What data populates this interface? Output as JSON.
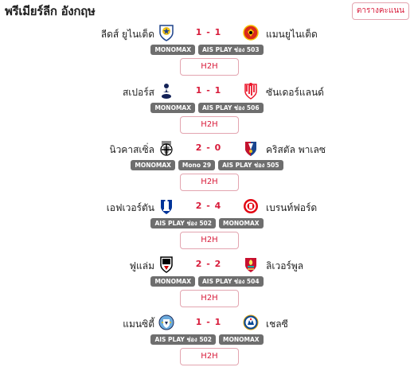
{
  "header": {
    "title": "พรีเมียร์ลีก อังกฤษ",
    "standings_label": "ตารางคะแนน"
  },
  "matches": [
    {
      "home": "ลีดส์ ยูไนเต็ด",
      "away": "แมนยูไนเต็ด",
      "score": "1 - 1",
      "home_crest": "leeds-crest-icon",
      "away_crest": "man-utd-crest-icon",
      "channels": [
        "MONOMAX",
        "AIS PLAY ช่อง 503"
      ],
      "h2h": "H2H"
    },
    {
      "home": "สเปอร์ส",
      "away": "ซันเดอร์แลนด์",
      "score": "1 - 1",
      "home_crest": "tottenham-crest-icon",
      "away_crest": "sunderland-crest-icon",
      "channels": [
        "MONOMAX",
        "AIS PLAY ช่อง 506"
      ],
      "h2h": "H2H"
    },
    {
      "home": "นิวคาสเซิ่ล",
      "away": "คริสตัล พาเลซ",
      "score": "2 - 0",
      "home_crest": "newcastle-crest-icon",
      "away_crest": "crystal-palace-crest-icon",
      "channels": [
        "MONOMAX",
        "Mono 29",
        "AIS PLAY ช่อง 505"
      ],
      "h2h": "H2H"
    },
    {
      "home": "เอฟเวอร์ตัน",
      "away": "เบรนท์ฟอร์ด",
      "score": "2 - 4",
      "home_crest": "everton-crest-icon",
      "away_crest": "brentford-crest-icon",
      "channels": [
        "AIS PLAY ช่อง 502",
        "MONOMAX"
      ],
      "h2h": "H2H"
    },
    {
      "home": "ฟูแล่ม",
      "away": "ลิเวอร์พูล",
      "score": "2 - 2",
      "home_crest": "fulham-crest-icon",
      "away_crest": "liverpool-crest-icon",
      "channels": [
        "MONOMAX",
        "AIS PLAY ช่อง 504"
      ],
      "h2h": "H2H"
    },
    {
      "home": "แมนซิตี้",
      "away": "เชลซี",
      "score": "1 - 1",
      "home_crest": "man-city-crest-icon",
      "away_crest": "chelsea-crest-icon",
      "channels": [
        "AIS PLAY ช่อง 502",
        "MONOMAX"
      ],
      "h2h": "H2H"
    }
  ],
  "colors": {
    "accent": "#d81b3a",
    "channel_badge": "#6e6e6e"
  }
}
